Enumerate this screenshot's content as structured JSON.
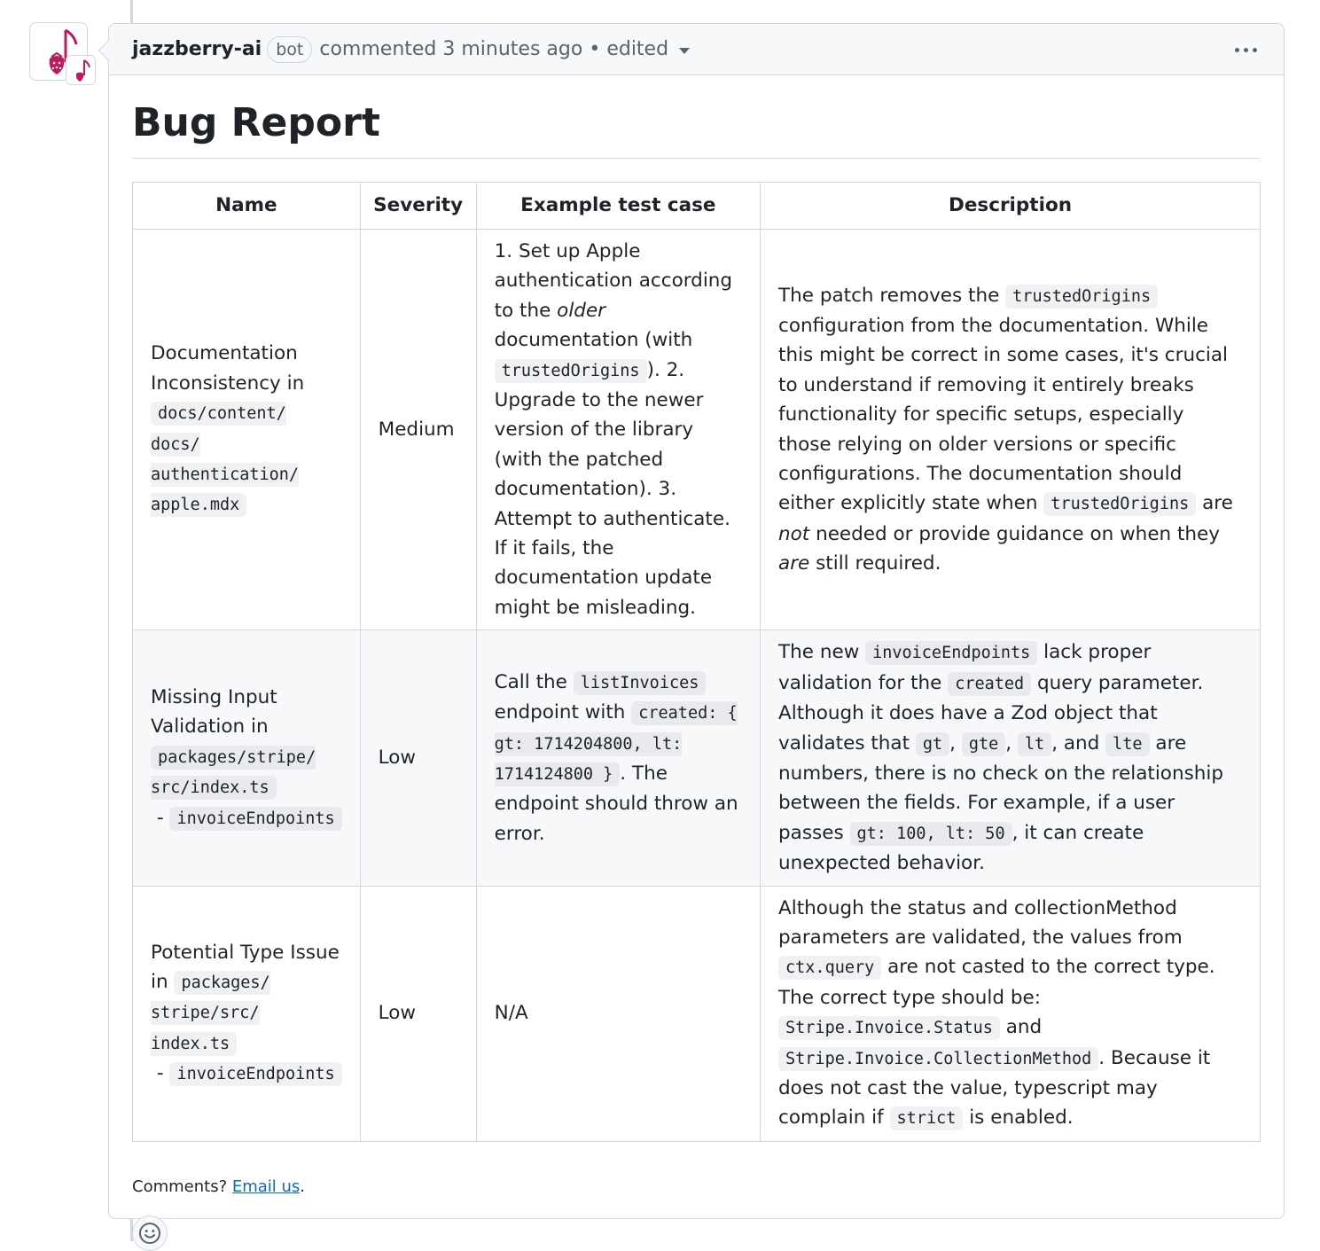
{
  "comment": {
    "author": "jazzberry-ai",
    "badge": "bot",
    "meta": "commented 3 minutes ago",
    "separator": " • ",
    "edited": "edited"
  },
  "report": {
    "title": "Bug Report",
    "columns": [
      "Name",
      "Severity",
      "Example test case",
      "Description"
    ],
    "rows": [
      {
        "name": {
          "text": "Documentation Inconsistency in ",
          "code": "docs/content/ docs/ authentication/ apple.mdx",
          "suffix": "",
          "code2": ""
        },
        "severity": "Medium",
        "test_case": {
          "t1": "1. Set up Apple authentication according to the ",
          "em1": "older",
          "t2": " documentation (with ",
          "c1": "trustedOrigins",
          "t3": "). 2. Upgrade to the newer version of the library (with the patched documentation). 3. Attempt to authenticate. If it fails, the documentation update might be misleading."
        },
        "description": {
          "t1": "The patch removes the ",
          "c1": "trustedOrigins",
          "t2": " configuration from the documentation. While this might be correct in some cases, it's crucial to understand if removing it entirely breaks functionality for specific setups, especially those relying on older versions or specific configurations. The documentation should either explicitly state when ",
          "c2": "trustedOrigins",
          "t3": " are ",
          "em1": "not",
          "t4": " needed or provide guidance on when they ",
          "em2": "are",
          "t5": " still required."
        }
      },
      {
        "name": {
          "text": "Missing Input Validation in ",
          "code": "packages/stripe/ src/index.ts",
          "suffix": " - ",
          "code2": "invoiceEndpoints"
        },
        "severity": "Low",
        "test_case": {
          "t1": "Call the ",
          "c1": "listInvoices",
          "t2": " endpoint with ",
          "c2": "created: { gt: 1714204800, lt: 1714124800 }",
          "t3": ". The endpoint should throw an error."
        },
        "description": {
          "t1": "The new ",
          "c1": "invoiceEndpoints",
          "t2": " lack proper validation for the ",
          "c2": "created",
          "t3": " query parameter. Although it does have a Zod object that validates that ",
          "c3": "gt",
          "t4": ", ",
          "c4": "gte",
          "t5": ", ",
          "c5": "lt",
          "t6": ", and ",
          "c6": "lte",
          "t7": " are numbers, there is no check on the relationship between the fields. For example, if a user passes ",
          "c7": "gt: 100, lt: 50",
          "t8": ", it can create unexpected behavior."
        }
      },
      {
        "name": {
          "text": "Potential Type Issue in ",
          "code": "packages/ stripe/src/ index.ts",
          "suffix": " - ",
          "code2": "invoiceEndpoints"
        },
        "severity": "Low",
        "test_case": "N/A",
        "description": {
          "t1": "Although the status and collectionMethod parameters are validated, the values from ",
          "c1": "ctx.query",
          "t2": " are not casted to the correct type. The correct type should be: ",
          "c2": "Stripe.Invoice.Status",
          "t3": " and ",
          "c3": "Stripe.Invoice.CollectionMethod",
          "t4": ". Because it does not cast the value, typescript may complain if ",
          "c4": "strict",
          "t5": " is enabled."
        }
      }
    ]
  },
  "footer": {
    "prefix": "Comments? ",
    "link": "Email us",
    "suffix": "."
  },
  "icons": {
    "avatar": "jazzberry-logo-icon",
    "menu": "kebab-horizontal-icon",
    "reaction": "smiley-icon"
  },
  "colors": {
    "brand": "#c2185b",
    "link": "#0969da"
  }
}
